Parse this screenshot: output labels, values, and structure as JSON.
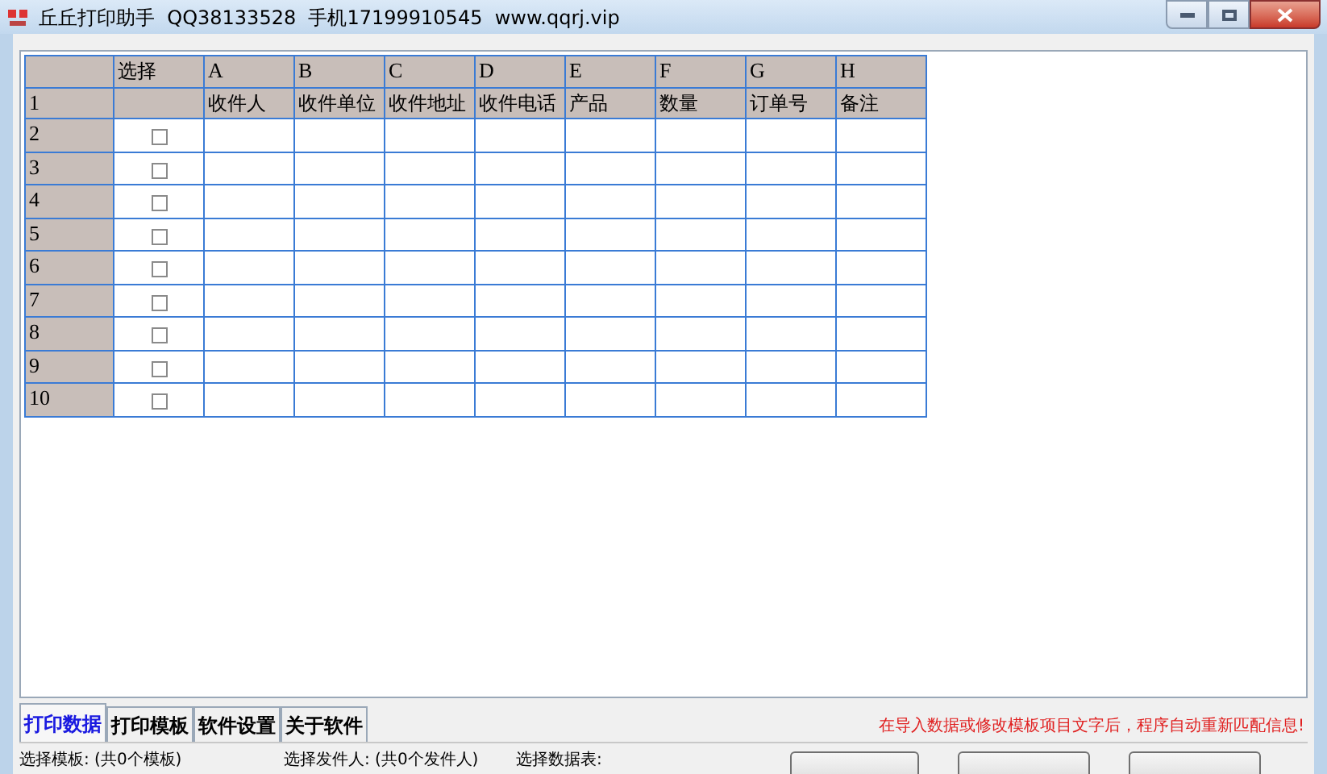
{
  "window": {
    "title": "丘丘打印助手  QQ38133528  手机17199910545  www.qqrj.vip"
  },
  "grid": {
    "select_header": "选择",
    "column_letters": [
      "A",
      "B",
      "C",
      "D",
      "E",
      "F",
      "G",
      "H"
    ],
    "field_row": {
      "number": "1",
      "fields": [
        "收件人",
        "收件单位",
        "收件地址",
        "收件电话",
        "产品",
        "数量",
        "订单号",
        "备注"
      ]
    },
    "rows": [
      {
        "number": "2",
        "checked": false
      },
      {
        "number": "3",
        "checked": false
      },
      {
        "number": "4",
        "checked": false
      },
      {
        "number": "5",
        "checked": false
      },
      {
        "number": "6",
        "checked": false
      },
      {
        "number": "7",
        "checked": false
      },
      {
        "number": "8",
        "checked": false
      },
      {
        "number": "9",
        "checked": false
      },
      {
        "number": "10",
        "checked": false
      }
    ]
  },
  "tabs": [
    {
      "label": "打印数据",
      "selected": true
    },
    {
      "label": "打印模板",
      "selected": false
    },
    {
      "label": "软件设置",
      "selected": false
    },
    {
      "label": "关于软件",
      "selected": false
    }
  ],
  "notice": "在导入数据或修改模板项目文字后，程序自动重新匹配信息!",
  "selectors": [
    {
      "label": "选择模板: (共0个模板)"
    },
    {
      "label": "选择发件人: (共0个发件人)"
    },
    {
      "label": "选择数据表:"
    }
  ]
}
